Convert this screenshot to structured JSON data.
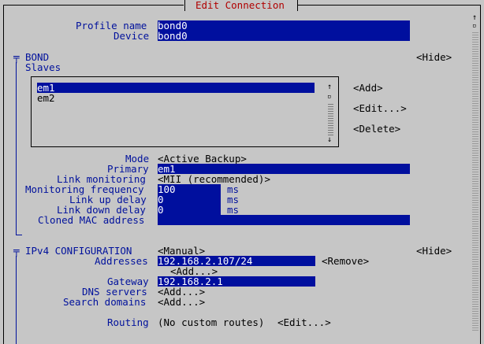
{
  "window": {
    "title": "Edit Connection"
  },
  "profile": {
    "name_label": "Profile name",
    "name_value": "bond0",
    "device_label": "Device",
    "device_value": "bond0"
  },
  "bond": {
    "section_label": "BOND",
    "hide_label": "<Hide>",
    "slaves_label": "Slaves",
    "slaves": [
      "em1",
      "em2"
    ],
    "selected_slave": "em1",
    "add_label": "<Add>",
    "edit_label": "<Edit...>",
    "delete_label": "<Delete>",
    "mode_label": "Mode",
    "mode_value": "<Active Backup>",
    "primary_label": "Primary",
    "primary_value": "em1",
    "link_monitoring_label": "Link monitoring",
    "link_monitoring_value": "<MII (recommended)>",
    "monitoring_frequency_label": "Monitoring frequency",
    "monitoring_frequency_value": "100",
    "link_up_delay_label": "Link up delay",
    "link_up_delay_value": "0",
    "link_down_delay_label": "Link down delay",
    "link_down_delay_value": "0",
    "ms_unit": "ms",
    "cloned_mac_label": "Cloned MAC address",
    "cloned_mac_value": ""
  },
  "ipv4": {
    "section_label": "IPv4 CONFIGURATION",
    "method_value": "<Manual>",
    "hide_label": "<Hide>",
    "addresses_label": "Addresses",
    "address_value": "192.168.2.107/24",
    "remove_label": "<Remove>",
    "add_label": "<Add...>",
    "gateway_label": "Gateway",
    "gateway_value": "192.168.2.1",
    "dns_label": "DNS servers",
    "dns_add": "<Add...>",
    "search_label": "Search domains",
    "search_add": "<Add...>",
    "routing_label": "Routing",
    "routing_value": "(No custom routes)",
    "routing_edit": "<Edit...>"
  },
  "colors": {
    "background": "#c6c6c6",
    "field": "#000f9e",
    "label": "#00119c",
    "title": "#b00000"
  }
}
